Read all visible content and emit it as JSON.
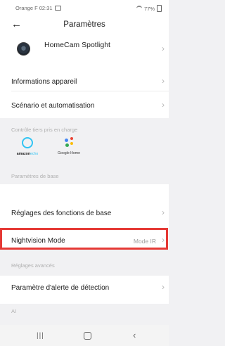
{
  "status_bar": {
    "carrier_time": "Orange F 02:31",
    "battery": "77%"
  },
  "header": {
    "title": "Paramètres",
    "back_icon": "back-arrow-icon"
  },
  "device": {
    "name": "HomeCam Spotlight"
  },
  "menu": {
    "device_info": "Informations appareil",
    "scenario": "Scénario et automatisation"
  },
  "sections": {
    "third_party": "Contrôle tiers pris en charge",
    "basic": "Paramètres de base",
    "advanced": "Réglages avancés",
    "ai": "AI"
  },
  "third_party": {
    "alexa": {
      "word1": "amazon",
      "word2": "echo"
    },
    "google": "Google Home"
  },
  "basic": {
    "functions": "Réglages des fonctions de base"
  },
  "nightvision": {
    "label": "Nightvision Mode",
    "value": "Mode IR"
  },
  "advanced": {
    "detection": "Paramètre d'alerte de détection"
  },
  "colors": {
    "highlight": "#e53935",
    "alexa": "#31c4f3"
  }
}
